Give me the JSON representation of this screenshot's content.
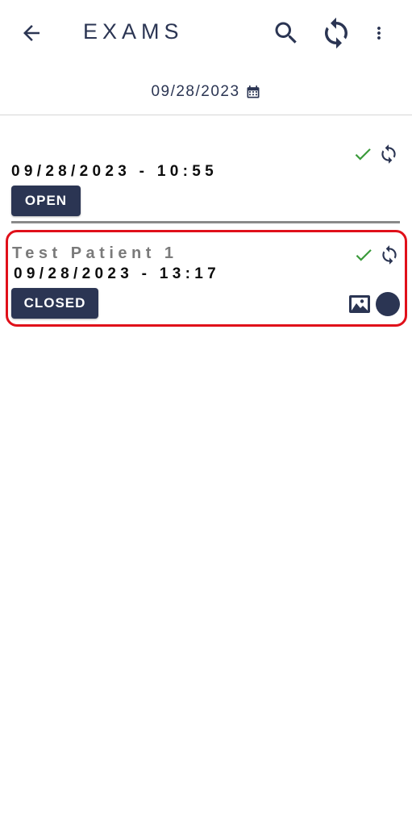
{
  "app_bar": {
    "title": "EXAMS",
    "back_icon": "arrow-left-icon",
    "search_icon": "search-icon",
    "sync_icon": "sync-icon",
    "menu_icon": "more-vert-icon"
  },
  "date_filter": {
    "date": "09/28/2023",
    "icon": "calendar-icon"
  },
  "exams": [
    {
      "patient_name": "",
      "datetime": "09/28/2023 - 10:55",
      "status": "OPEN",
      "synced": true
    },
    {
      "patient_name": "Test Patient 1",
      "datetime": "09/28/2023 - 13:17",
      "status": "CLOSED",
      "synced": true,
      "has_image": true
    }
  ],
  "colors": {
    "primary": "#2b3553",
    "check": "#3a9a3a",
    "highlight": "#e0101a"
  }
}
